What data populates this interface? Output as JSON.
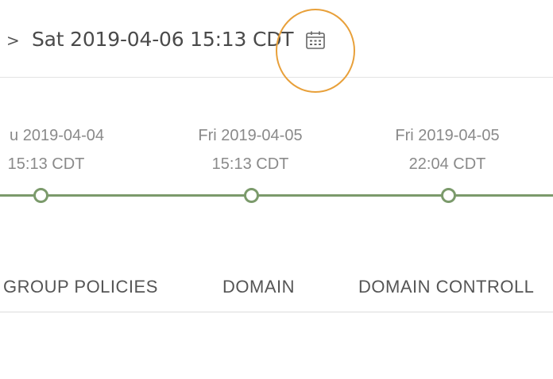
{
  "header": {
    "prev_chevron": ">",
    "current_datetime": "Sat 2019-04-06 15:13 CDT",
    "calendar_icon": "calendar-icon"
  },
  "highlight": {
    "color": "#e8a03a"
  },
  "timeline": {
    "line_color": "#7b9a6b",
    "points": [
      {
        "date": "u 2019-04-04",
        "time": "15:13 CDT"
      },
      {
        "date": "Fri 2019-04-05",
        "time": "15:13 CDT"
      },
      {
        "date": "Fri 2019-04-05",
        "time": "22:04 CDT"
      }
    ]
  },
  "tabs": [
    {
      "label": "GROUP POLICIES"
    },
    {
      "label": "DOMAIN"
    },
    {
      "label": "DOMAIN CONTROLL"
    }
  ]
}
